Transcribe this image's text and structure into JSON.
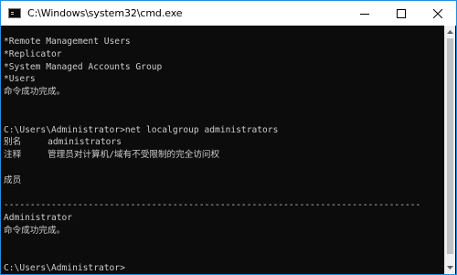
{
  "window": {
    "title": "C:\\Windows\\system32\\cmd.exe",
    "icon": "cmd-icon"
  },
  "controls": {
    "minimize_icon": "minimize-icon",
    "maximize_icon": "maximize-icon",
    "close_icon": "close-icon"
  },
  "console": {
    "lines": [
      "*Remote Management Users",
      "*Replicator",
      "*System Managed Accounts Group",
      "*Users",
      "命令成功完成。",
      "",
      "",
      "C:\\Users\\Administrator>net localgroup administrators",
      "别名     administrators",
      "注释     管理员对计算机/域有不受限制的完全访问权",
      "",
      "成员",
      "",
      "-------------------------------------------------------------------------------",
      "Administrator",
      "命令成功完成。",
      "",
      "",
      "C:\\Users\\Administrator>"
    ]
  },
  "colors": {
    "console_background": "#0c0c0c",
    "console_text": "#cccccc",
    "window_border": "#1e90e6",
    "titlebar": "#ffffff"
  }
}
